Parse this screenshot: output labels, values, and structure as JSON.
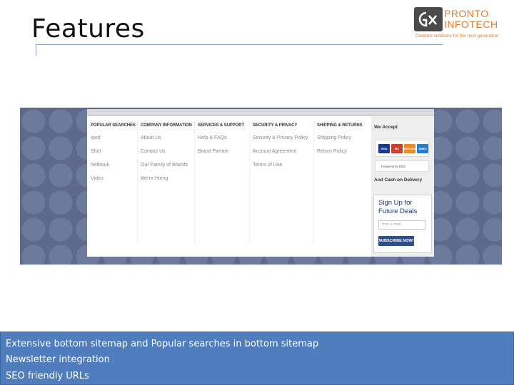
{
  "slide": {
    "title": "Features"
  },
  "logo": {
    "line1": "PRONTO",
    "line2": "INFOTECH",
    "tagline": "Creative solutions for the next generation",
    "icon": "gx-logo-icon"
  },
  "screenshot": {
    "columns": [
      {
        "head": "POPULAR SEARCHES",
        "items": [
          "Ipod",
          "Shirt",
          "Netbook",
          "Video"
        ]
      },
      {
        "head": "COMPANY INFORMATION",
        "items": [
          "About Us",
          "Contact Us",
          "Our Family of Brands",
          "We're Hiring"
        ]
      },
      {
        "head": "SERVICES & SUPPORT",
        "items": [
          "Help & FAQs",
          "Brand Partner"
        ]
      },
      {
        "head": "SECURITY & PRIVACY",
        "items": [
          "Security & Privacy Policy",
          "Account Agreement",
          "Terms of Use"
        ]
      },
      {
        "head": "SHIPPING & RETURNS",
        "items": [
          "Shipping Policy",
          "Return Policy"
        ]
      }
    ],
    "accept": {
      "head": "We Accept",
      "cards": [
        {
          "label": "VISA",
          "color": "#1a3a8c"
        },
        {
          "label": "MC",
          "color": "#c8402a"
        },
        {
          "label": "DISCOVER",
          "color": "#e88a2a"
        },
        {
          "label": "AMEX",
          "color": "#2a7ac8"
        }
      ],
      "powered_by": "Powered by EBS",
      "cod": "And Cash on Delivery"
    },
    "signup": {
      "title_line1": "Sign Up for",
      "title_line2": "Future Deals",
      "placeholder": "Your e-mail",
      "button": "SUBSCRIBE NOW!"
    }
  },
  "bottom": {
    "lines": [
      "Extensive bottom sitemap and Popular searches in bottom sitemap",
      "Newsletter integration",
      "SEO friendly URLs"
    ]
  },
  "colors": {
    "accent": "#4f7dbd",
    "logo_orange": "#e07a2c"
  }
}
